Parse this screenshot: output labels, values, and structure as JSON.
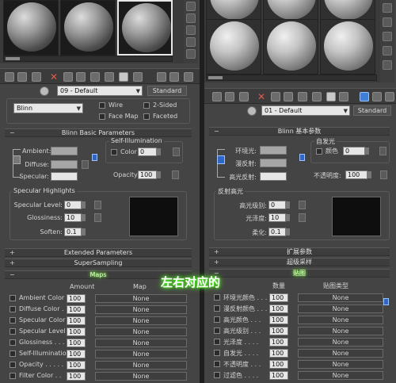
{
  "left": {
    "material_name": "09 - Default",
    "material_type": "Standard",
    "shader": "Blinn",
    "shader_options": {
      "wire": "Wire",
      "two_sided": "2-Sided",
      "face_map": "Face Map",
      "faceted": "Faceted"
    },
    "basic_params_title": "Blinn Basic Parameters",
    "self_illum_title": "Self-Illumination",
    "color_label": "Color",
    "color_value": "0",
    "ambient": "Ambient:",
    "diffuse": "Diffuse:",
    "specular": "Specular:",
    "opacity_label": "Opacity:",
    "opacity_value": "100",
    "highlights_title": "Specular Highlights",
    "spec_level_label": "Specular Level:",
    "spec_level_value": "0",
    "glossiness_label": "Glossiness:",
    "glossiness_value": "10",
    "soften_label": "Soften:",
    "soften_value": "0.1",
    "extended_title": "Extended Parameters",
    "supersampling_title": "SuperSampling",
    "maps_title": "Maps",
    "amount_header": "Amount",
    "map_header": "Map",
    "maps": [
      {
        "label": "Ambient Color . .",
        "amount": "100",
        "map": "None"
      },
      {
        "label": "Diffuse Color . .",
        "amount": "100",
        "map": "None"
      },
      {
        "label": "Specular Color . .",
        "amount": "100",
        "map": "None"
      },
      {
        "label": "Specular Level . .",
        "amount": "100",
        "map": "None"
      },
      {
        "label": "Glossiness . . . .",
        "amount": "100",
        "map": "None"
      },
      {
        "label": "Self-Illumination .",
        "amount": "100",
        "map": "None"
      },
      {
        "label": "Opacity . . . . .",
        "amount": "100",
        "map": "None"
      },
      {
        "label": "Filter Color . .",
        "amount": "100",
        "map": "None"
      }
    ]
  },
  "right": {
    "material_name": "01 - Default",
    "material_type": "Standard",
    "basic_params_title": "Blinn 基本参数",
    "self_illum_title": "自发光",
    "color_label": "颜色",
    "color_value": "0",
    "ambient": "环境光:",
    "diffuse": "漫反射:",
    "specular": "高光反射:",
    "opacity_label": "不透明度:",
    "opacity_value": "100",
    "highlights_title": "反射高光",
    "spec_level_label": "高光级别:",
    "spec_level_value": "0",
    "glossiness_label": "光泽度:",
    "glossiness_value": "10",
    "soften_label": "柔化:",
    "soften_value": "0.1",
    "extended_title": "扩展参数",
    "supersampling_title": "超级采样",
    "maps_title": "贴图",
    "amount_header": "数量",
    "map_header": "贴图类型",
    "maps": [
      {
        "label": "环境光颜色 . . .",
        "amount": "100",
        "map": "None"
      },
      {
        "label": "漫反射颜色 . . .",
        "amount": "100",
        "map": "None"
      },
      {
        "label": "高光颜色 . . .",
        "amount": "100",
        "map": "None"
      },
      {
        "label": "高光级别 . . .",
        "amount": "100",
        "map": "None"
      },
      {
        "label": "光泽度 . . . .",
        "amount": "100",
        "map": "None"
      },
      {
        "label": "自发光 . . . .",
        "amount": "100",
        "map": "None"
      },
      {
        "label": "不透明度 . . .",
        "amount": "100",
        "map": "None"
      },
      {
        "label": "过滤色 . . . .",
        "amount": "100",
        "map": "None"
      }
    ]
  },
  "annotation": "左右对应的"
}
